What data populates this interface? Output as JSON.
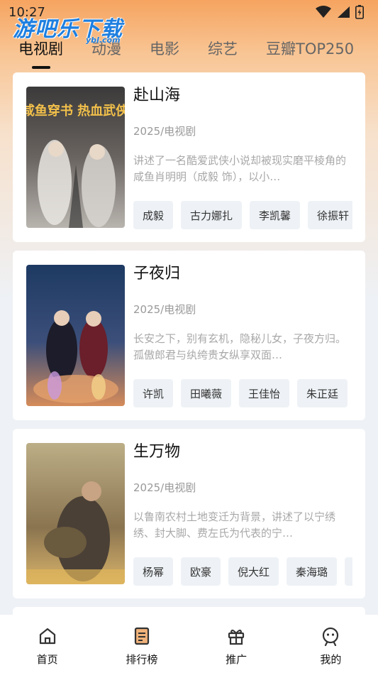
{
  "status_bar": {
    "time": "10:27"
  },
  "watermark": {
    "text": "游吧乐下载",
    "sub": "ybl.com"
  },
  "tabs": [
    {
      "label": "电视剧",
      "active": true
    },
    {
      "label": "动漫",
      "active": false
    },
    {
      "label": "电影",
      "active": false
    },
    {
      "label": "综艺",
      "active": false
    },
    {
      "label": "豆瓣TOP250",
      "active": false
    }
  ],
  "items": [
    {
      "title": "赴山海",
      "meta": "2025/电视剧",
      "desc": "讲述了一名酷爱武侠小说却被现实磨平棱角的咸鱼肖明明（成毅 饰），以小…",
      "poster_text": "咸鱼穿书 热血武侠",
      "actors": [
        "成毅",
        "古力娜扎",
        "李凯馨",
        "徐振轩"
      ]
    },
    {
      "title": "子夜归",
      "meta": "2025/电视剧",
      "desc": "长安之下，别有玄机，隐秘儿女，子夜方归。孤傲郎君与纨绔贵女纵享双面…",
      "actors": [
        "许凯",
        "田曦薇",
        "王佳怡",
        "朱正廷"
      ]
    },
    {
      "title": "生万物",
      "meta": "2025/电视剧",
      "desc": "以鲁南农村土地变迁为背景，讲述了以宁绣绣、封大脚、费左氏为代表的宁…",
      "actors": [
        "杨幂",
        "欧豪",
        "倪大红",
        "秦海璐"
      ]
    }
  ],
  "bottom_nav": [
    {
      "label": "首页",
      "icon": "home-icon"
    },
    {
      "label": "排行榜",
      "icon": "ranking-icon"
    },
    {
      "label": "推广",
      "icon": "gift-icon"
    },
    {
      "label": "我的",
      "icon": "profile-icon"
    }
  ],
  "colors": {
    "accent": "#f6a460",
    "tag_bg": "#eef2f6",
    "watermark": "#1e7fe0"
  }
}
